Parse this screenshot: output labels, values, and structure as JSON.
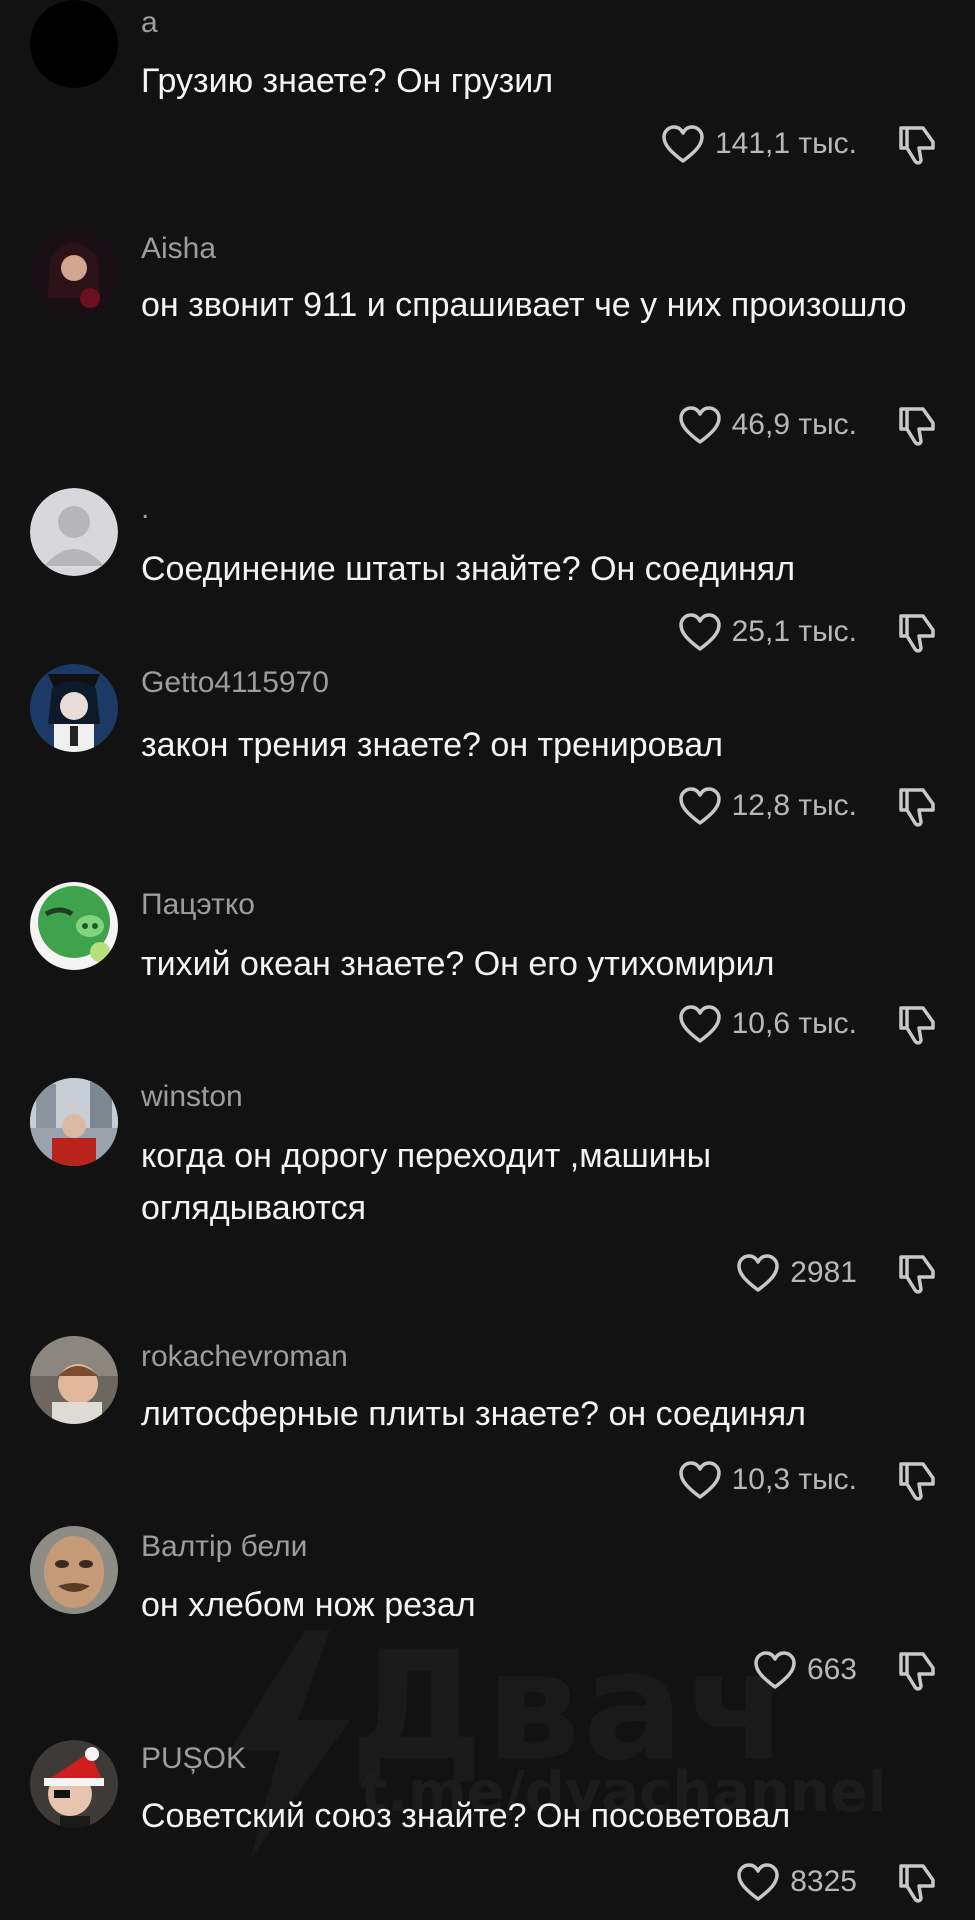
{
  "watermark": {
    "title": "Двач",
    "url": "t.me/dvachannel"
  },
  "comments": [
    {
      "username": "a",
      "text": "Грузию знаете? Он грузил",
      "likes": "141,1 тыс.",
      "avatar": "black-circle-avatar"
    },
    {
      "username": "Aisha",
      "text": "он звонит 911 и спрашивает че у них произошло",
      "likes": "46,9 тыс.",
      "avatar": "photo-avatar"
    },
    {
      "username": ".",
      "text": "Соединение штаты знайте? Он соединял",
      "likes": "25,1 тыс.",
      "avatar": "default-user-avatar"
    },
    {
      "username": "Getto4115970",
      "text": "закон трения знаете? он тренировал",
      "likes": "12,8 тыс.",
      "avatar": "anime-avatar"
    },
    {
      "username": "Пацэтко",
      "text": "тихий океан знаете? Он его утихомирил",
      "likes": "10,6 тыс.",
      "avatar": "green-pig-avatar"
    },
    {
      "username": "winston",
      "text": "когда он дорогу переходит ,машины оглядываются",
      "likes": "2981",
      "avatar": "photo-avatar"
    },
    {
      "username": "rokachevroman",
      "text": "литосферные плиты знаете? он соединял",
      "likes": "10,3 тыс.",
      "avatar": "photo-avatar"
    },
    {
      "username": "Валтір бели",
      "text": "он хлебом нож резал",
      "likes": "663",
      "avatar": "face-avatar"
    },
    {
      "username": "PUȘOK",
      "text": "Советский союз знайте? Он посоветовал",
      "likes": "8325",
      "avatar": "santa-hat-avatar"
    }
  ],
  "icons": {
    "like": "heart-outline-icon",
    "dislike": "thumbs-down-icon"
  },
  "colors": {
    "background": "#121212",
    "text": "#f4f4f4",
    "username": "#9d9d9d",
    "count": "#b8b8b8"
  }
}
